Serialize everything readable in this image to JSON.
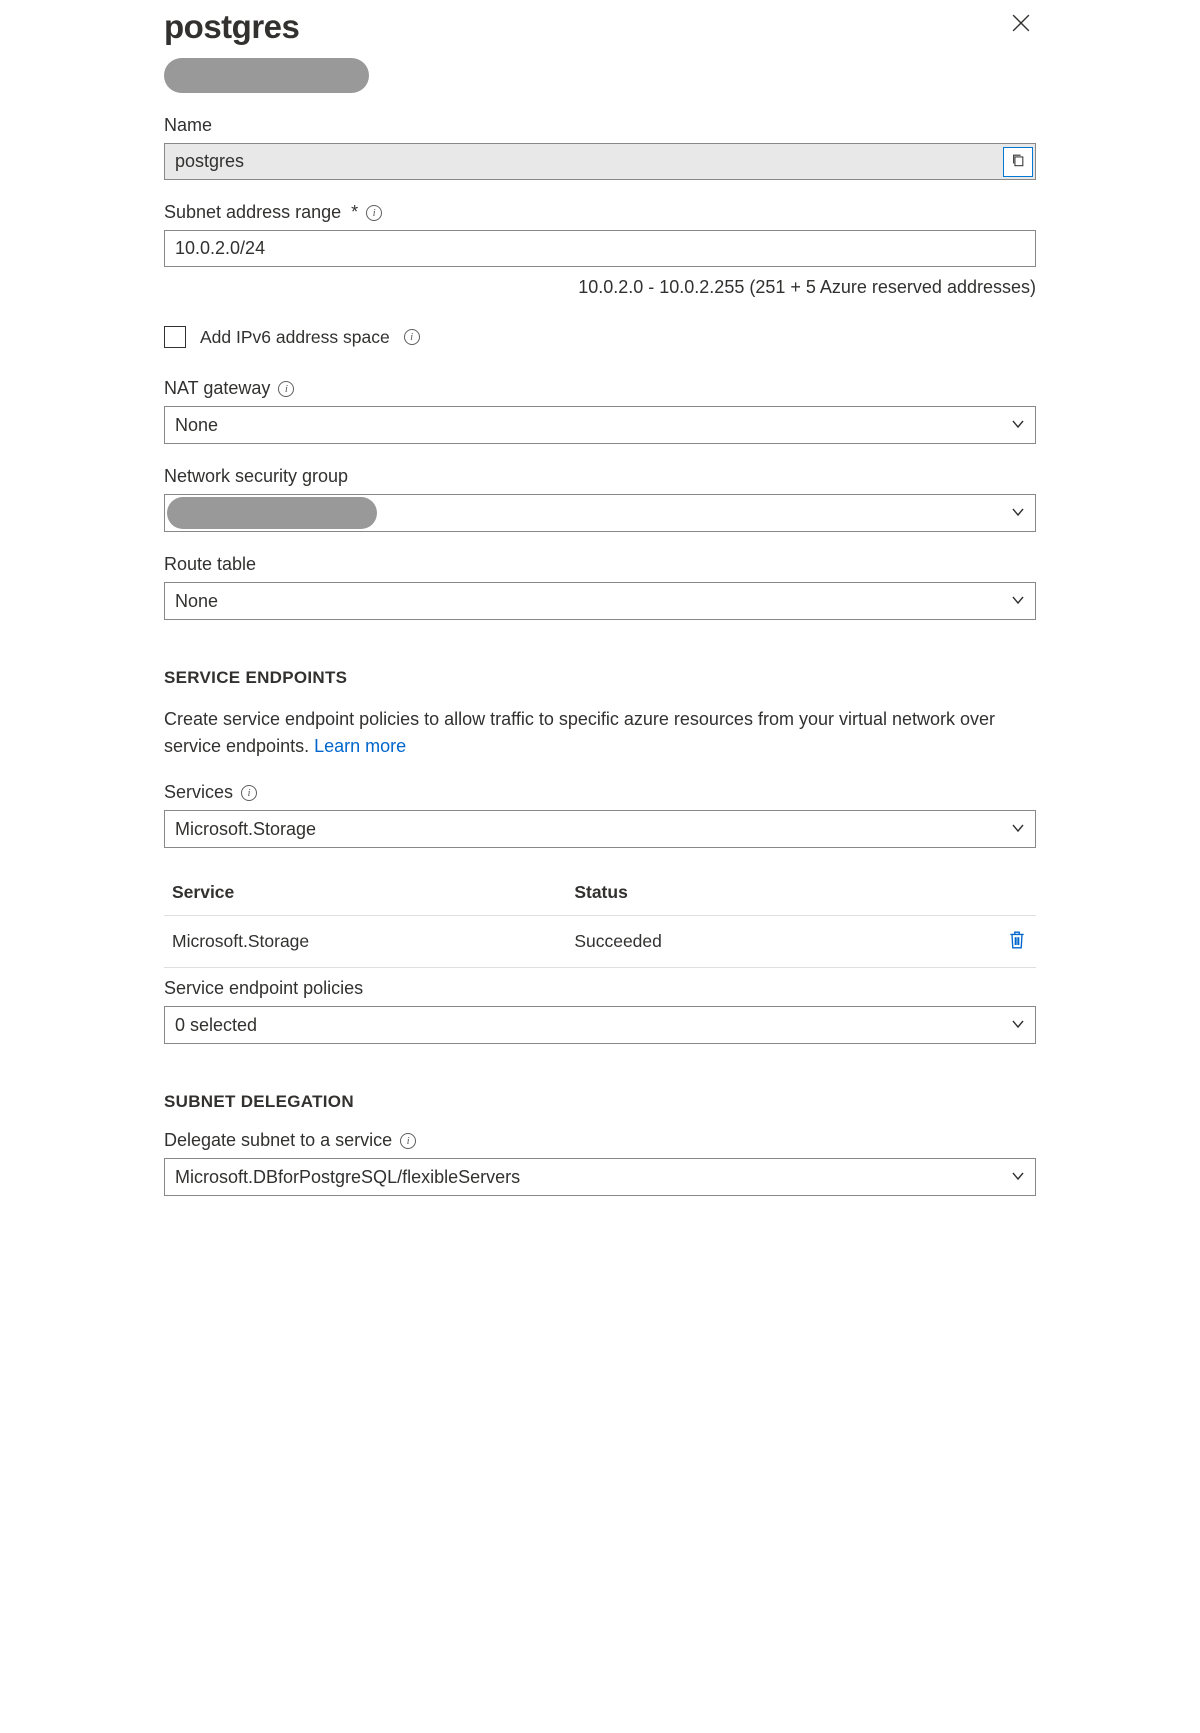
{
  "header": {
    "title": "postgres"
  },
  "fields": {
    "name": {
      "label": "Name",
      "value": "postgres"
    },
    "subnet_range": {
      "label": "Subnet address range",
      "required_mark": "*",
      "value": "10.0.2.0/24",
      "helper": "10.0.2.0 - 10.0.2.255 (251 + 5 Azure reserved addresses)"
    },
    "ipv6_checkbox": {
      "label": "Add IPv6 address space"
    },
    "nat_gateway": {
      "label": "NAT gateway",
      "value": "None"
    },
    "nsg": {
      "label": "Network security group",
      "value": ""
    },
    "route_table": {
      "label": "Route table",
      "value": "None"
    }
  },
  "service_endpoints": {
    "heading": "SERVICE ENDPOINTS",
    "description": "Create service endpoint policies to allow traffic to specific azure resources from your virtual network over service endpoints. ",
    "learn_more": "Learn more",
    "services_label": "Services",
    "services_value": "Microsoft.Storage",
    "table": {
      "col_service": "Service",
      "col_status": "Status",
      "rows": [
        {
          "service": "Microsoft.Storage",
          "status": "Succeeded"
        }
      ]
    },
    "policies_label": "Service endpoint policies",
    "policies_value": "0 selected"
  },
  "delegation": {
    "heading": "SUBNET DELEGATION",
    "label": "Delegate subnet to a service",
    "value": "Microsoft.DBforPostgreSQL/flexibleServers"
  }
}
